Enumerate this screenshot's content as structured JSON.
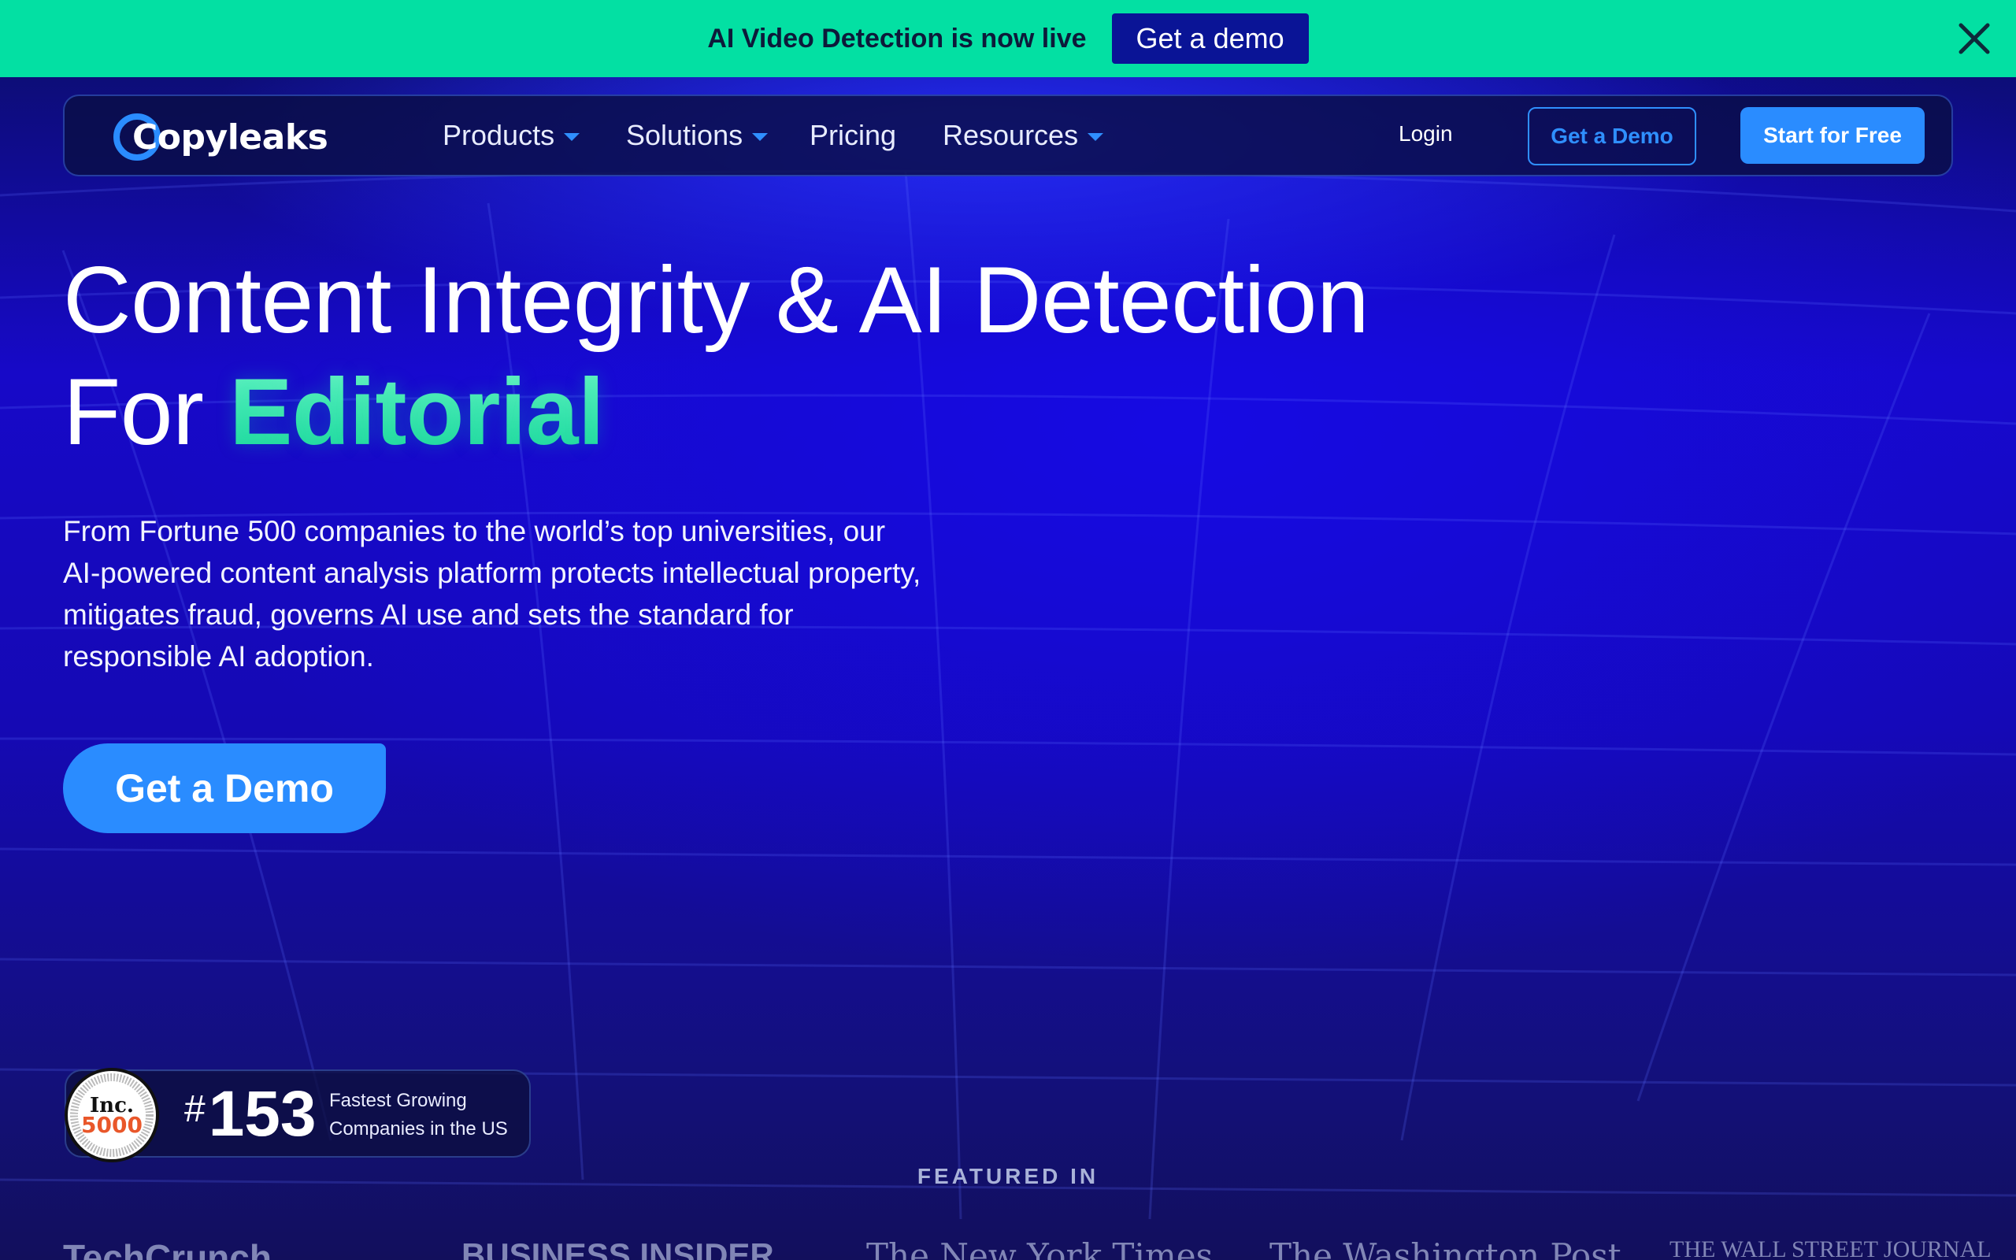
{
  "announcement": {
    "text": "AI Video Detection is now live",
    "button": "Get a demo",
    "close_icon": "close-icon"
  },
  "nav": {
    "logo_text": "Copyleaks",
    "items": [
      {
        "label": "Products",
        "dropdown": true
      },
      {
        "label": "Solutions",
        "dropdown": true
      },
      {
        "label": "Pricing",
        "dropdown": false
      },
      {
        "label": "Resources",
        "dropdown": true
      }
    ],
    "login": "Login",
    "demo_button": "Get a Demo",
    "start_button": "Start for Free"
  },
  "hero": {
    "headline_line1": "Content Integrity & AI Detection",
    "headline_prefix": "For",
    "headline_accent": "Editorial",
    "subcopy": "From Fortune 500 companies to the world’s top universities, our AI-powered content analysis platform protects intellectual property, mitigates fraud, governs AI use and sets the standard for responsible AI adoption.",
    "cta": "Get a Demo"
  },
  "badge": {
    "seal_top": "Inc.",
    "seal_number": "5000",
    "hash": "#",
    "rank": "153",
    "line1": "Fastest Growing",
    "line2": "Companies in the US"
  },
  "featured": {
    "title": "FEATURED IN",
    "logos": [
      "TechCrunch",
      "BUSINESS INSIDER",
      "The New York Times",
      "The Washington Post",
      "THE WALL STREET JOURNAL"
    ]
  },
  "colors": {
    "announcement_bg": "#03e0a3",
    "primary_blue": "#2a8cff",
    "accent_green": "#18d49a",
    "hero_bg": "#1509b4"
  }
}
